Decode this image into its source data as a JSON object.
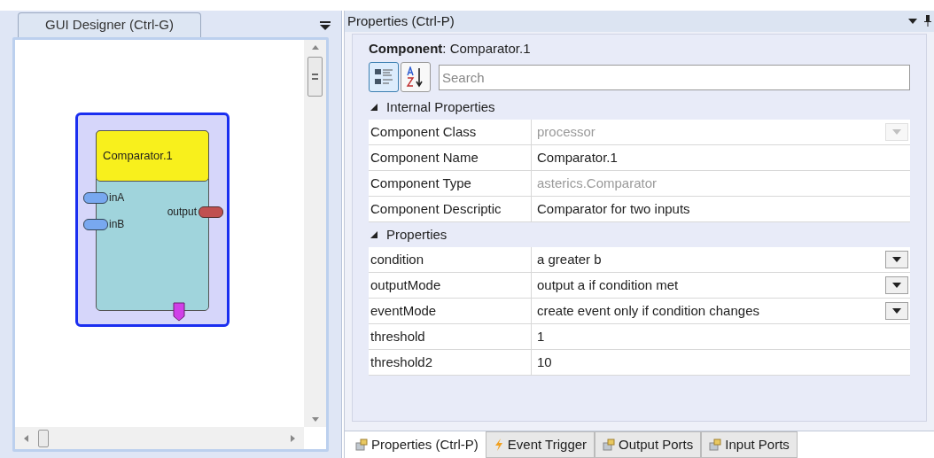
{
  "designer": {
    "tab": "GUI Designer (Ctrl-G)",
    "component": {
      "title": "Comparator.1",
      "inputs": [
        "inA",
        "inB"
      ],
      "outputs": [
        "output"
      ]
    }
  },
  "properties": {
    "title": "Properties (Ctrl-P)",
    "component_heading": "**Component**: Comparator.1",
    "view_buttons": [
      {
        "kind": "categorized",
        "selected": true
      },
      {
        "kind": "alphabetical",
        "selected": false
      }
    ],
    "search": {
      "placeholder": "Search"
    },
    "categories": [
      {
        "name": "Internal Properties",
        "expanded": true,
        "rows": [
          {
            "label": "Component Class",
            "value": "processor",
            "kind": "dropdown",
            "disabled": true
          },
          {
            "label": "Component Name",
            "value": "Comparator.1",
            "kind": "text",
            "disabled": false
          },
          {
            "label": "Component Type",
            "value": "asterics.Comparator",
            "kind": "text",
            "disabled": true
          },
          {
            "label": "Component Descriptic",
            "value": "Comparator for two inputs",
            "kind": "text",
            "disabled": false
          }
        ]
      },
      {
        "name": "Properties",
        "expanded": true,
        "rows": [
          {
            "label": "condition",
            "value": "a greater b",
            "kind": "dropdown",
            "disabled": false
          },
          {
            "label": "outputMode",
            "value": "output a if condition met",
            "kind": "dropdown",
            "disabled": false
          },
          {
            "label": "eventMode",
            "value": "create event only if condition changes",
            "kind": "dropdown",
            "disabled": false
          },
          {
            "label": "threshold",
            "value": "1",
            "kind": "text",
            "disabled": false
          },
          {
            "label": "threshold2",
            "value": "10",
            "kind": "text",
            "disabled": false
          }
        ]
      }
    ]
  },
  "bottom_tabs": [
    {
      "label": "Properties (Ctrl-P)",
      "kind": "component",
      "selected": true
    },
    {
      "label": "Event Trigger",
      "kind": "event",
      "selected": false
    },
    {
      "label": "Output Ports",
      "kind": "component",
      "selected": false
    },
    {
      "label": "Input Ports",
      "kind": "component",
      "selected": false
    }
  ]
}
